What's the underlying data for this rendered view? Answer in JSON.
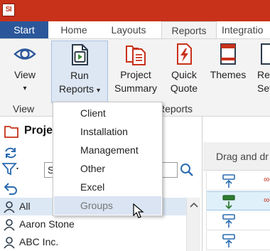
{
  "app": {
    "logo_text": "SI",
    "accent": "#c8311a"
  },
  "tabs": [
    {
      "label": "Start"
    },
    {
      "label": "Home"
    },
    {
      "label": "Layouts"
    },
    {
      "label": "Reports"
    },
    {
      "label": "Integratio"
    }
  ],
  "ribbon": {
    "view": {
      "label": "View",
      "arrow": "▾"
    },
    "run_reports": {
      "line1": "Run",
      "line2": "Reports",
      "arrow": "▾"
    },
    "project_summary": {
      "line1": "Project",
      "line2": "Summary"
    },
    "quick_quote": {
      "line1": "Quick",
      "line2": "Quote"
    },
    "themes": {
      "label": "Themes"
    },
    "more": {
      "line1": "Re",
      "line2": "Set"
    },
    "groups": {
      "view_label": "View",
      "reports_label": "Reports"
    }
  },
  "dropdown": {
    "items": [
      {
        "label": "Client"
      },
      {
        "label": "Installation"
      },
      {
        "label": "Management"
      },
      {
        "label": "Other"
      },
      {
        "label": "Excel"
      },
      {
        "label": "Groups"
      }
    ]
  },
  "project_panel": {
    "title": "Proje",
    "search_value": "S",
    "list": [
      {
        "label": "All"
      },
      {
        "label": "Aaron Stone"
      },
      {
        "label": "ABC Inc."
      }
    ]
  },
  "right_panel": {
    "drag_text": "Drag and dr"
  }
}
